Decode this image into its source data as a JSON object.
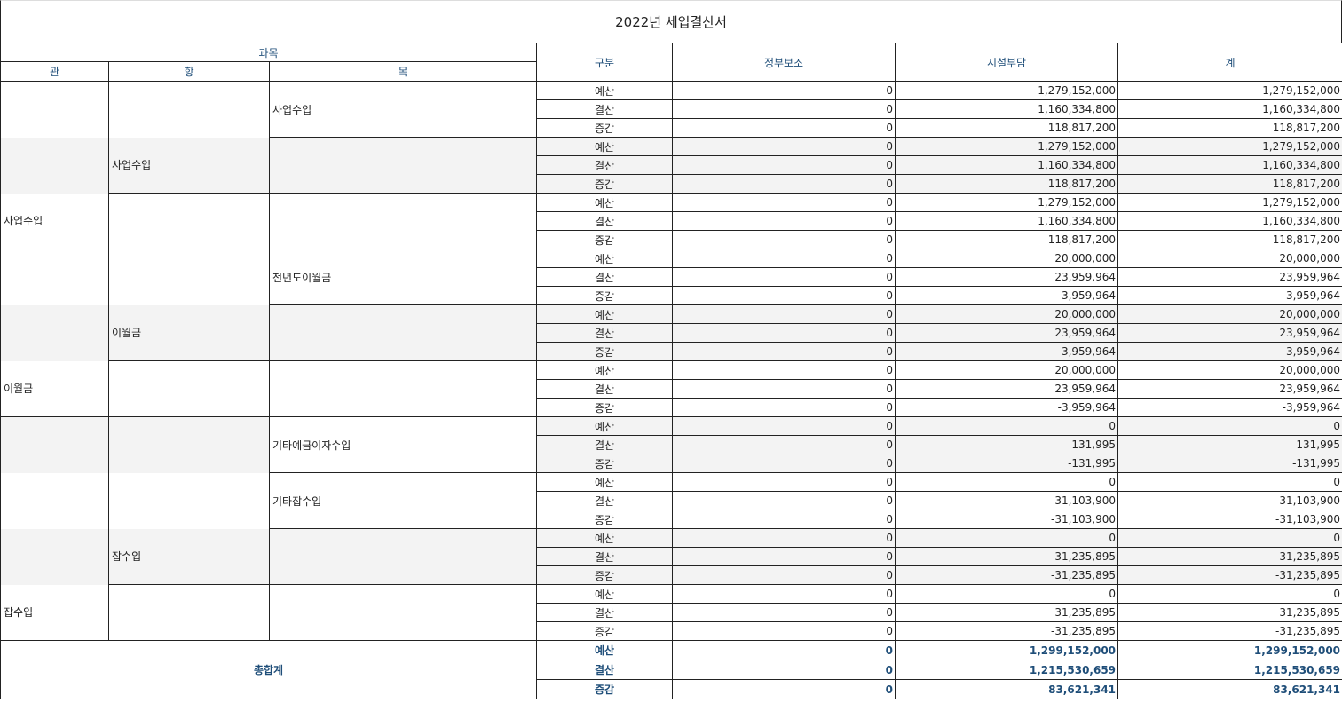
{
  "title": "2022년 세입결산서",
  "header": {
    "gwamok": "과목",
    "gwan": "관",
    "hang": "항",
    "mok": "목",
    "gubun": "구분",
    "col1": "정부보조",
    "col2": "시설부담",
    "col3": "계"
  },
  "blocks": [
    {
      "gwan": "",
      "hang": "",
      "mok": "사업수입",
      "gray": false,
      "rows": [
        {
          "g": "예산",
          "a": "0",
          "b": "1,279,152,000",
          "c": "1,279,152,000"
        },
        {
          "g": "결산",
          "a": "0",
          "b": "1,160,334,800",
          "c": "1,160,334,800"
        },
        {
          "g": "증감",
          "a": "0",
          "b": "118,817,200",
          "c": "118,817,200"
        }
      ]
    },
    {
      "gwan": "",
      "hang": "사업수입",
      "mok": "",
      "gray": true,
      "rows": [
        {
          "g": "예산",
          "a": "0",
          "b": "1,279,152,000",
          "c": "1,279,152,000"
        },
        {
          "g": "결산",
          "a": "0",
          "b": "1,160,334,800",
          "c": "1,160,334,800"
        },
        {
          "g": "증감",
          "a": "0",
          "b": "118,817,200",
          "c": "118,817,200"
        }
      ]
    },
    {
      "gwan": "사업수입",
      "hang": "",
      "mok": "",
      "gray": false,
      "rows": [
        {
          "g": "예산",
          "a": "0",
          "b": "1,279,152,000",
          "c": "1,279,152,000"
        },
        {
          "g": "결산",
          "a": "0",
          "b": "1,160,334,800",
          "c": "1,160,334,800"
        },
        {
          "g": "증감",
          "a": "0",
          "b": "118,817,200",
          "c": "118,817,200"
        }
      ]
    },
    {
      "gwan": "",
      "hang": "",
      "mok": "전년도이월금",
      "gray": false,
      "rows": [
        {
          "g": "예산",
          "a": "0",
          "b": "20,000,000",
          "c": "20,000,000"
        },
        {
          "g": "결산",
          "a": "0",
          "b": "23,959,964",
          "c": "23,959,964"
        },
        {
          "g": "증감",
          "a": "0",
          "b": "-3,959,964",
          "c": "-3,959,964"
        }
      ]
    },
    {
      "gwan": "",
      "hang": "이월금",
      "mok": "",
      "gray": true,
      "rows": [
        {
          "g": "예산",
          "a": "0",
          "b": "20,000,000",
          "c": "20,000,000"
        },
        {
          "g": "결산",
          "a": "0",
          "b": "23,959,964",
          "c": "23,959,964"
        },
        {
          "g": "증감",
          "a": "0",
          "b": "-3,959,964",
          "c": "-3,959,964"
        }
      ]
    },
    {
      "gwan": "이월금",
      "hang": "",
      "mok": "",
      "gray": false,
      "rows": [
        {
          "g": "예산",
          "a": "0",
          "b": "20,000,000",
          "c": "20,000,000"
        },
        {
          "g": "결산",
          "a": "0",
          "b": "23,959,964",
          "c": "23,959,964"
        },
        {
          "g": "증감",
          "a": "0",
          "b": "-3,959,964",
          "c": "-3,959,964"
        }
      ]
    },
    {
      "gwan": "",
      "hang": "",
      "mok": "기타예금이자수입",
      "gray": true,
      "grayMok": false,
      "rows": [
        {
          "g": "예산",
          "a": "0",
          "b": "0",
          "c": "0"
        },
        {
          "g": "결산",
          "a": "0",
          "b": "131,995",
          "c": "131,995"
        },
        {
          "g": "증감",
          "a": "0",
          "b": "-131,995",
          "c": "-131,995"
        }
      ]
    },
    {
      "gwan": "",
      "hang": "",
      "mok": "기타잡수입",
      "gray": false,
      "rows": [
        {
          "g": "예산",
          "a": "0",
          "b": "0",
          "c": "0"
        },
        {
          "g": "결산",
          "a": "0",
          "b": "31,103,900",
          "c": "31,103,900"
        },
        {
          "g": "증감",
          "a": "0",
          "b": "-31,103,900",
          "c": "-31,103,900"
        }
      ]
    },
    {
      "gwan": "",
      "hang": "잡수입",
      "mok": "",
      "gray": true,
      "rows": [
        {
          "g": "예산",
          "a": "0",
          "b": "0",
          "c": "0"
        },
        {
          "g": "결산",
          "a": "0",
          "b": "31,235,895",
          "c": "31,235,895"
        },
        {
          "g": "증감",
          "a": "0",
          "b": "-31,235,895",
          "c": "-31,235,895"
        }
      ]
    },
    {
      "gwan": "잡수입",
      "hang": "",
      "mok": "",
      "gray": false,
      "rows": [
        {
          "g": "예산",
          "a": "0",
          "b": "0",
          "c": "0"
        },
        {
          "g": "결산",
          "a": "0",
          "b": "31,235,895",
          "c": "31,235,895"
        },
        {
          "g": "증감",
          "a": "0",
          "b": "-31,235,895",
          "c": "-31,235,895"
        }
      ]
    }
  ],
  "total": {
    "label": "총합계",
    "rows": [
      {
        "g": "예산",
        "a": "0",
        "b": "1,299,152,000",
        "c": "1,299,152,000"
      },
      {
        "g": "결산",
        "a": "0",
        "b": "1,215,530,659",
        "c": "1,215,530,659"
      },
      {
        "g": "증감",
        "a": "0",
        "b": "83,621,341",
        "c": "83,621,341"
      }
    ]
  }
}
